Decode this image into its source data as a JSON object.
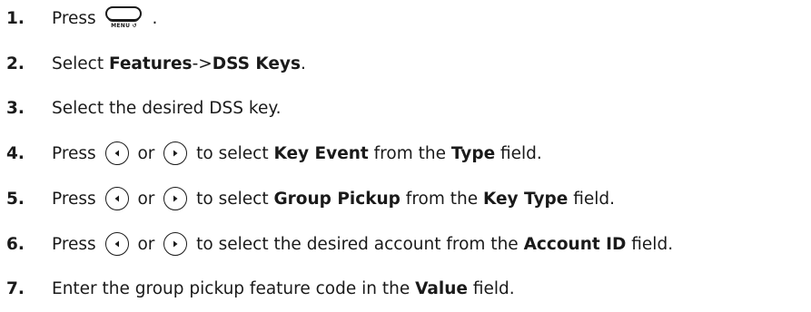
{
  "steps": [
    {
      "num": "1.",
      "parts": [
        {
          "t": "Press "
        },
        {
          "icon": "menu-key",
          "label": "MENU ↺"
        },
        {
          "t": " ."
        }
      ]
    },
    {
      "num": "2.",
      "parts": [
        {
          "t": "Select "
        },
        {
          "b": "Features"
        },
        {
          "t": "->"
        },
        {
          "b": "DSS Keys"
        },
        {
          "t": "."
        }
      ]
    },
    {
      "num": "3.",
      "parts": [
        {
          "t": "Select the desired DSS key."
        }
      ]
    },
    {
      "num": "4.",
      "parts": [
        {
          "t": "Press "
        },
        {
          "icon": "left-key"
        },
        {
          "t": " or "
        },
        {
          "icon": "right-key"
        },
        {
          "t": " to select "
        },
        {
          "b": "Key Event"
        },
        {
          "t": " from the "
        },
        {
          "b": "Type"
        },
        {
          "t": " field."
        }
      ]
    },
    {
      "num": "5.",
      "parts": [
        {
          "t": "Press "
        },
        {
          "icon": "left-key"
        },
        {
          "t": " or "
        },
        {
          "icon": "right-key"
        },
        {
          "t": " to select "
        },
        {
          "b": "Group Pickup"
        },
        {
          "t": " from the "
        },
        {
          "b": "Key Type"
        },
        {
          "t": " field."
        }
      ]
    },
    {
      "num": "6.",
      "parts": [
        {
          "t": "Press "
        },
        {
          "icon": "left-key"
        },
        {
          "t": " or "
        },
        {
          "icon": "right-key"
        },
        {
          "t": " to select the desired account from the "
        },
        {
          "b": "Account ID"
        },
        {
          "t": " field."
        }
      ]
    },
    {
      "num": "7.",
      "parts": [
        {
          "t": "Enter the group pickup feature code in the "
        },
        {
          "b": "Value"
        },
        {
          "t": " field."
        }
      ]
    }
  ]
}
